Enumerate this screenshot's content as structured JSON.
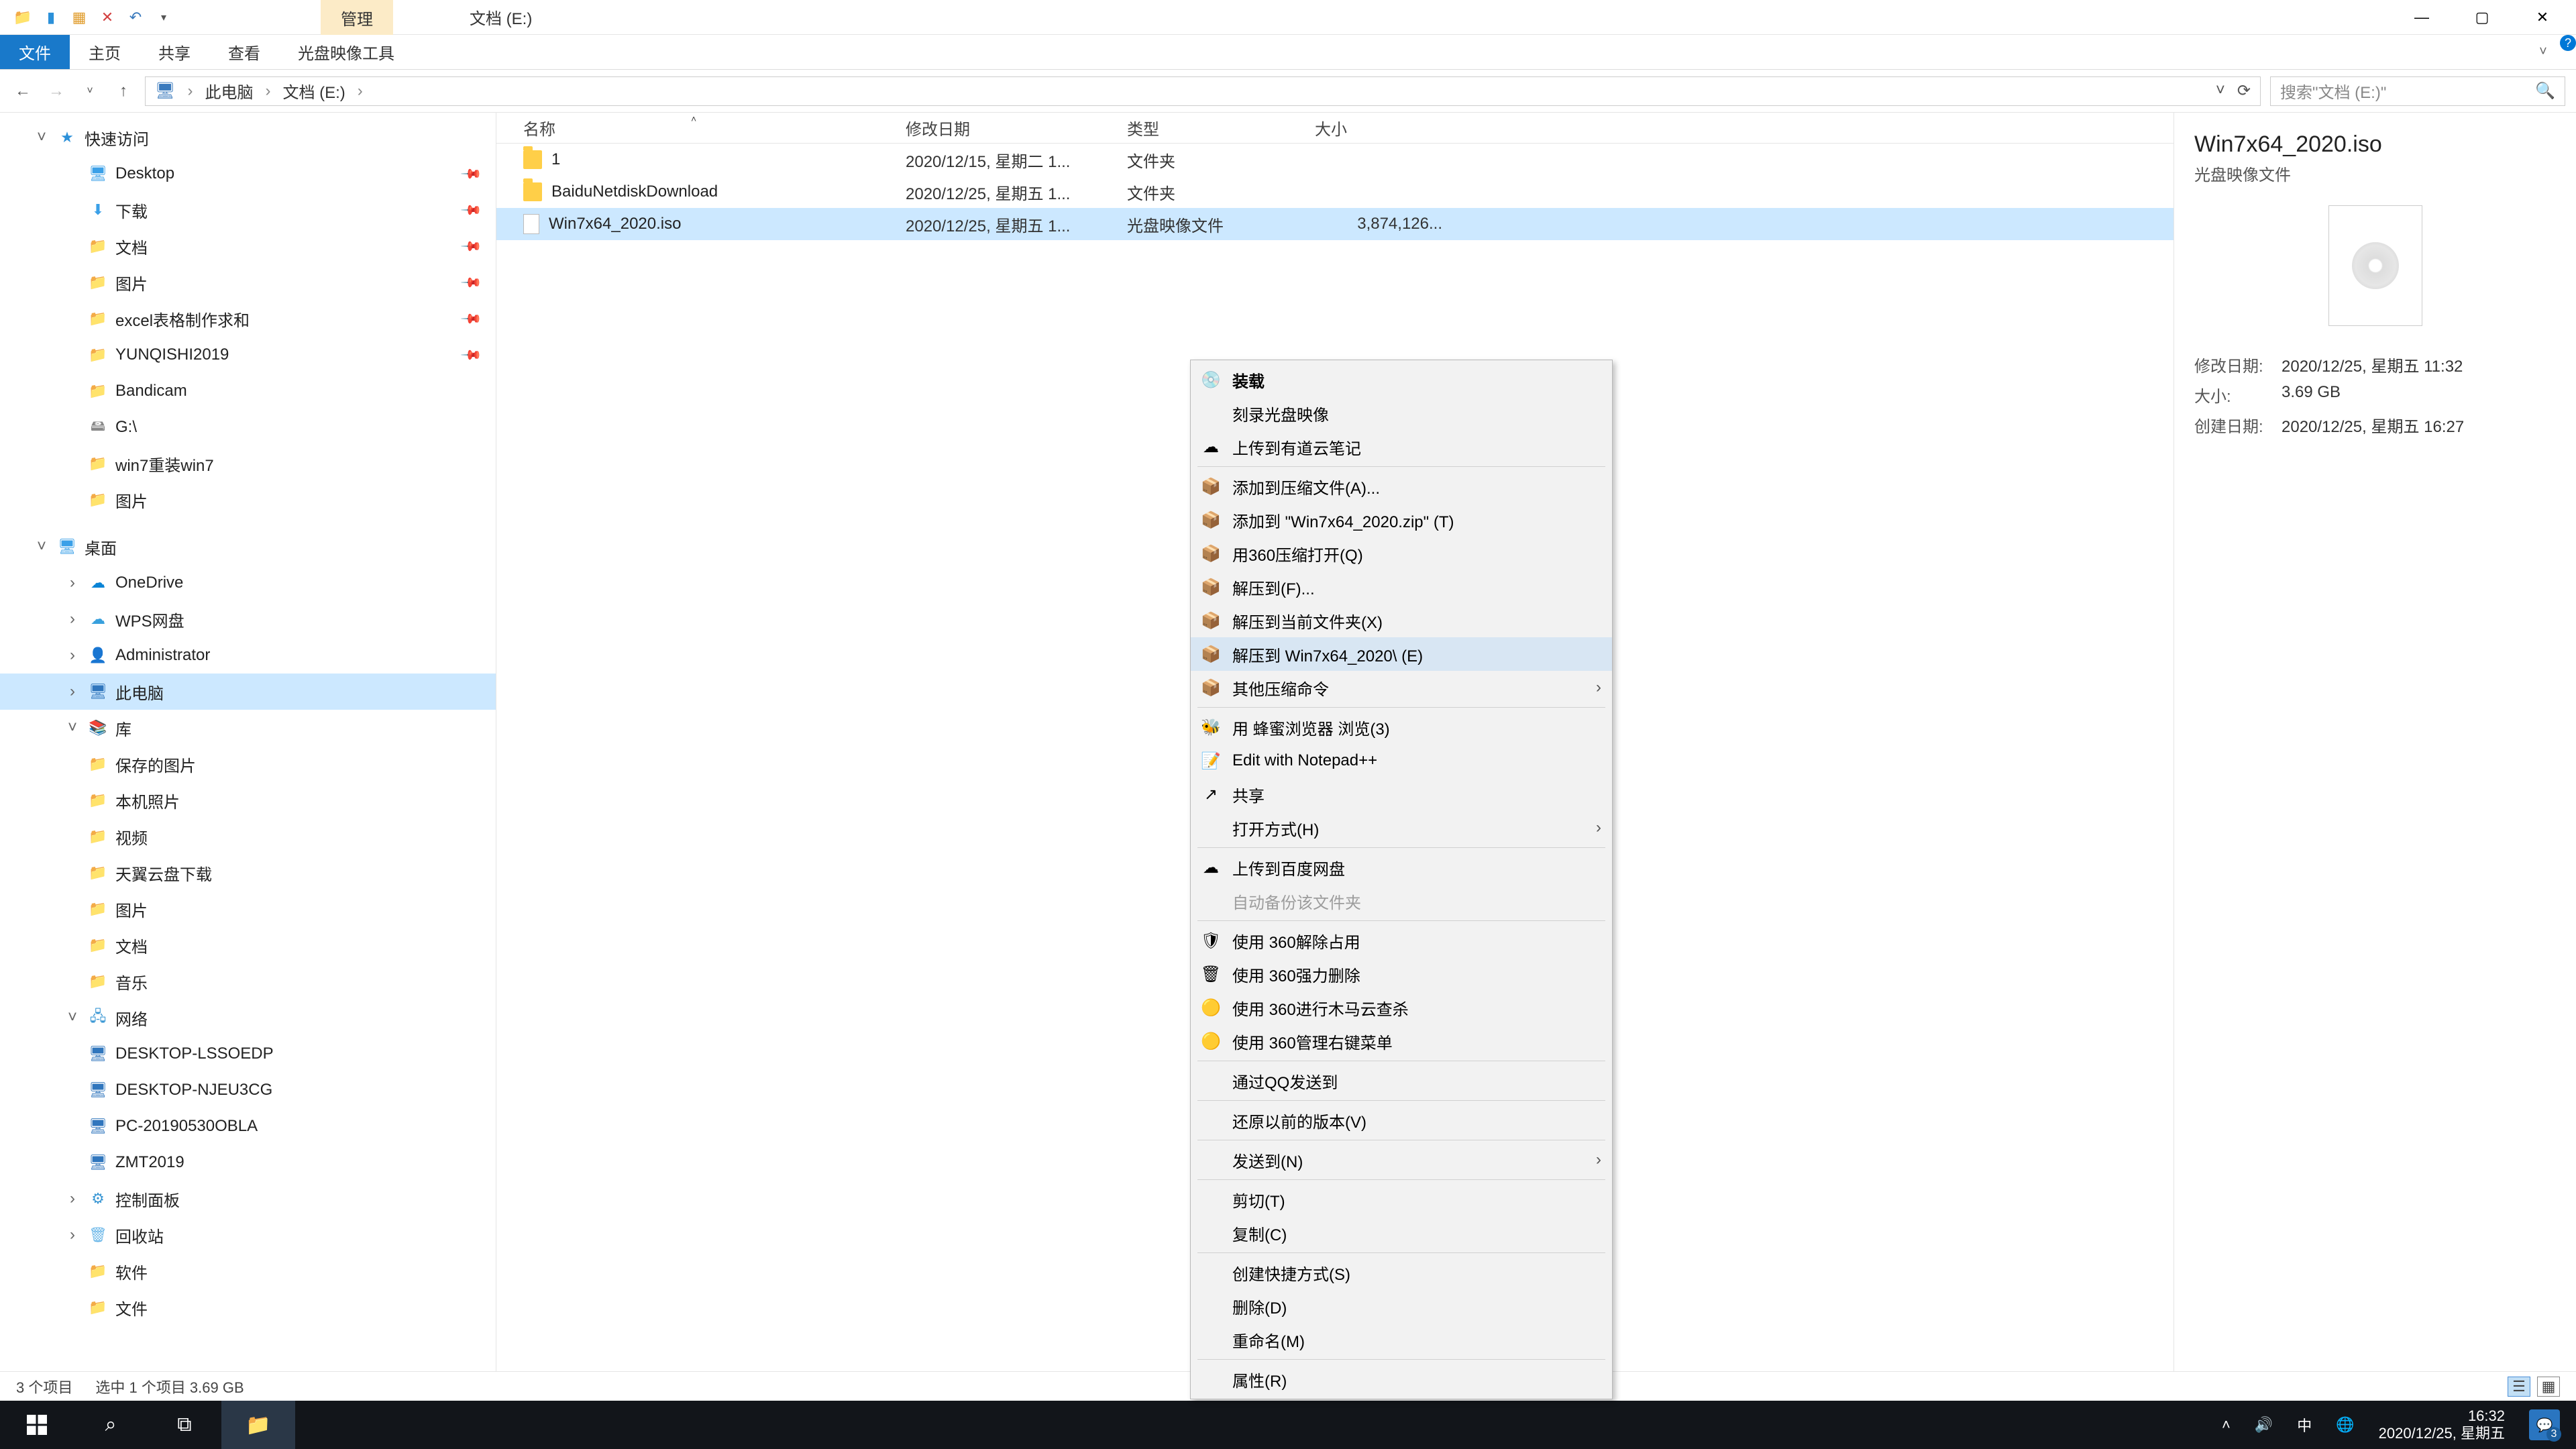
{
  "titlebar": {
    "context_tab": "管理",
    "title": "文档 (E:)"
  },
  "ribbon": {
    "file": "文件",
    "home": "主页",
    "share": "共享",
    "view": "查看",
    "context_tool": "光盘映像工具"
  },
  "nav": {
    "crumbs": [
      "此电脑",
      "文档 (E:)"
    ],
    "search_placeholder": "搜索\"文档 (E:)\""
  },
  "sidebar": [
    {
      "depth": 1,
      "icon": "star",
      "label": "快速访问",
      "exp": "v"
    },
    {
      "depth": 2,
      "icon": "desktop",
      "label": "Desktop",
      "pin": true
    },
    {
      "depth": 2,
      "icon": "download",
      "label": "下载",
      "pin": true
    },
    {
      "depth": 2,
      "icon": "folder",
      "label": "文档",
      "pin": true
    },
    {
      "depth": 2,
      "icon": "folder",
      "label": "图片",
      "pin": true
    },
    {
      "depth": 2,
      "icon": "folder",
      "label": "excel表格制作求和",
      "pin": true
    },
    {
      "depth": 2,
      "icon": "folder",
      "label": "YUNQISHI2019",
      "pin": true
    },
    {
      "depth": 2,
      "icon": "folder",
      "label": "Bandicam"
    },
    {
      "depth": 2,
      "icon": "drive",
      "label": "G:\\"
    },
    {
      "depth": 2,
      "icon": "folder",
      "label": "win7重装win7"
    },
    {
      "depth": 2,
      "icon": "folder",
      "label": "图片"
    },
    {
      "gap": true
    },
    {
      "depth": 1,
      "icon": "desktop",
      "label": "桌面",
      "exp": "v"
    },
    {
      "depth": 2,
      "icon": "onedrive",
      "label": "OneDrive",
      "exp": ">"
    },
    {
      "depth": 2,
      "icon": "wps",
      "label": "WPS网盘",
      "exp": ">"
    },
    {
      "depth": 2,
      "icon": "user",
      "label": "Administrator",
      "exp": ">"
    },
    {
      "depth": 2,
      "icon": "pc",
      "label": "此电脑",
      "exp": ">",
      "selected": true
    },
    {
      "depth": 2,
      "icon": "lib",
      "label": "库",
      "exp": "v"
    },
    {
      "depth": 3,
      "icon": "folder",
      "label": "保存的图片"
    },
    {
      "depth": 3,
      "icon": "folder",
      "label": "本机照片"
    },
    {
      "depth": 3,
      "icon": "folder",
      "label": "视频"
    },
    {
      "depth": 3,
      "icon": "folder",
      "label": "天翼云盘下载"
    },
    {
      "depth": 3,
      "icon": "folder",
      "label": "图片"
    },
    {
      "depth": 3,
      "icon": "folder",
      "label": "文档"
    },
    {
      "depth": 3,
      "icon": "folder",
      "label": "音乐"
    },
    {
      "depth": 2,
      "icon": "net",
      "label": "网络",
      "exp": "v"
    },
    {
      "depth": 3,
      "icon": "pc",
      "label": "DESKTOP-LSSOEDP"
    },
    {
      "depth": 3,
      "icon": "pc",
      "label": "DESKTOP-NJEU3CG"
    },
    {
      "depth": 3,
      "icon": "pc",
      "label": "PC-20190530OBLA"
    },
    {
      "depth": 3,
      "icon": "pc",
      "label": "ZMT2019"
    },
    {
      "depth": 2,
      "icon": "panel",
      "label": "控制面板",
      "exp": ">"
    },
    {
      "depth": 2,
      "icon": "bin",
      "label": "回收站",
      "exp": ">"
    },
    {
      "depth": 2,
      "icon": "folder",
      "label": "软件"
    },
    {
      "depth": 2,
      "icon": "folder",
      "label": "文件"
    }
  ],
  "columns": {
    "name": "名称",
    "date": "修改日期",
    "type": "类型",
    "size": "大小"
  },
  "files": [
    {
      "icon": "folder",
      "name": "1",
      "date": "2020/12/15, 星期二 1...",
      "type": "文件夹",
      "size": ""
    },
    {
      "icon": "folder",
      "name": "BaiduNetdiskDownload",
      "date": "2020/12/25, 星期五 1...",
      "type": "文件夹",
      "size": ""
    },
    {
      "icon": "iso",
      "name": "Win7x64_2020.iso",
      "date": "2020/12/25, 星期五 1...",
      "type": "光盘映像文件",
      "size": "3,874,126...",
      "selected": true
    }
  ],
  "context_menu": [
    {
      "icon": "disc",
      "label": "装载",
      "bold": true
    },
    {
      "icon": "",
      "label": "刻录光盘映像"
    },
    {
      "icon": "cloud",
      "label": "上传到有道云笔记"
    },
    {
      "sep": true
    },
    {
      "icon": "zip",
      "label": "添加到压缩文件(A)..."
    },
    {
      "icon": "zip",
      "label": "添加到 \"Win7x64_2020.zip\" (T)"
    },
    {
      "icon": "zip",
      "label": "用360压缩打开(Q)"
    },
    {
      "icon": "zip",
      "label": "解压到(F)..."
    },
    {
      "icon": "zip",
      "label": "解压到当前文件夹(X)"
    },
    {
      "icon": "zip",
      "label": "解压到 Win7x64_2020\\ (E)",
      "hover": true
    },
    {
      "icon": "zip",
      "label": "其他压缩命令",
      "sub": true
    },
    {
      "sep": true
    },
    {
      "icon": "bee",
      "label": "用 蜂蜜浏览器 浏览(3)"
    },
    {
      "icon": "npp",
      "label": "Edit with Notepad++"
    },
    {
      "icon": "share",
      "label": "共享"
    },
    {
      "icon": "",
      "label": "打开方式(H)",
      "sub": true
    },
    {
      "sep": true
    },
    {
      "icon": "baidu",
      "label": "上传到百度网盘"
    },
    {
      "icon": "",
      "label": "自动备份该文件夹",
      "disabled": true
    },
    {
      "sep": true
    },
    {
      "icon": "360",
      "label": "使用 360解除占用"
    },
    {
      "icon": "360d",
      "label": "使用 360强力删除"
    },
    {
      "icon": "360y",
      "label": "使用 360进行木马云查杀"
    },
    {
      "icon": "360y",
      "label": "使用 360管理右键菜单"
    },
    {
      "sep": true
    },
    {
      "icon": "",
      "label": "通过QQ发送到"
    },
    {
      "sep": true
    },
    {
      "icon": "",
      "label": "还原以前的版本(V)"
    },
    {
      "sep": true
    },
    {
      "icon": "",
      "label": "发送到(N)",
      "sub": true
    },
    {
      "sep": true
    },
    {
      "icon": "",
      "label": "剪切(T)"
    },
    {
      "icon": "",
      "label": "复制(C)"
    },
    {
      "sep": true
    },
    {
      "icon": "",
      "label": "创建快捷方式(S)"
    },
    {
      "icon": "",
      "label": "删除(D)"
    },
    {
      "icon": "",
      "label": "重命名(M)"
    },
    {
      "sep": true
    },
    {
      "icon": "",
      "label": "属性(R)"
    }
  ],
  "preview": {
    "title": "Win7x64_2020.iso",
    "subtitle": "光盘映像文件",
    "meta": [
      {
        "label": "修改日期:",
        "value": "2020/12/25, 星期五 11:32"
      },
      {
        "label": "大小:",
        "value": "3.69 GB"
      },
      {
        "label": "创建日期:",
        "value": "2020/12/25, 星期五 16:27"
      }
    ]
  },
  "status": {
    "count": "3 个项目",
    "selected": "选中 1 个项目  3.69 GB"
  },
  "taskbar": {
    "ime": "中",
    "time": "16:32",
    "date": "2020/12/25, 星期五",
    "notif_count": "3"
  }
}
